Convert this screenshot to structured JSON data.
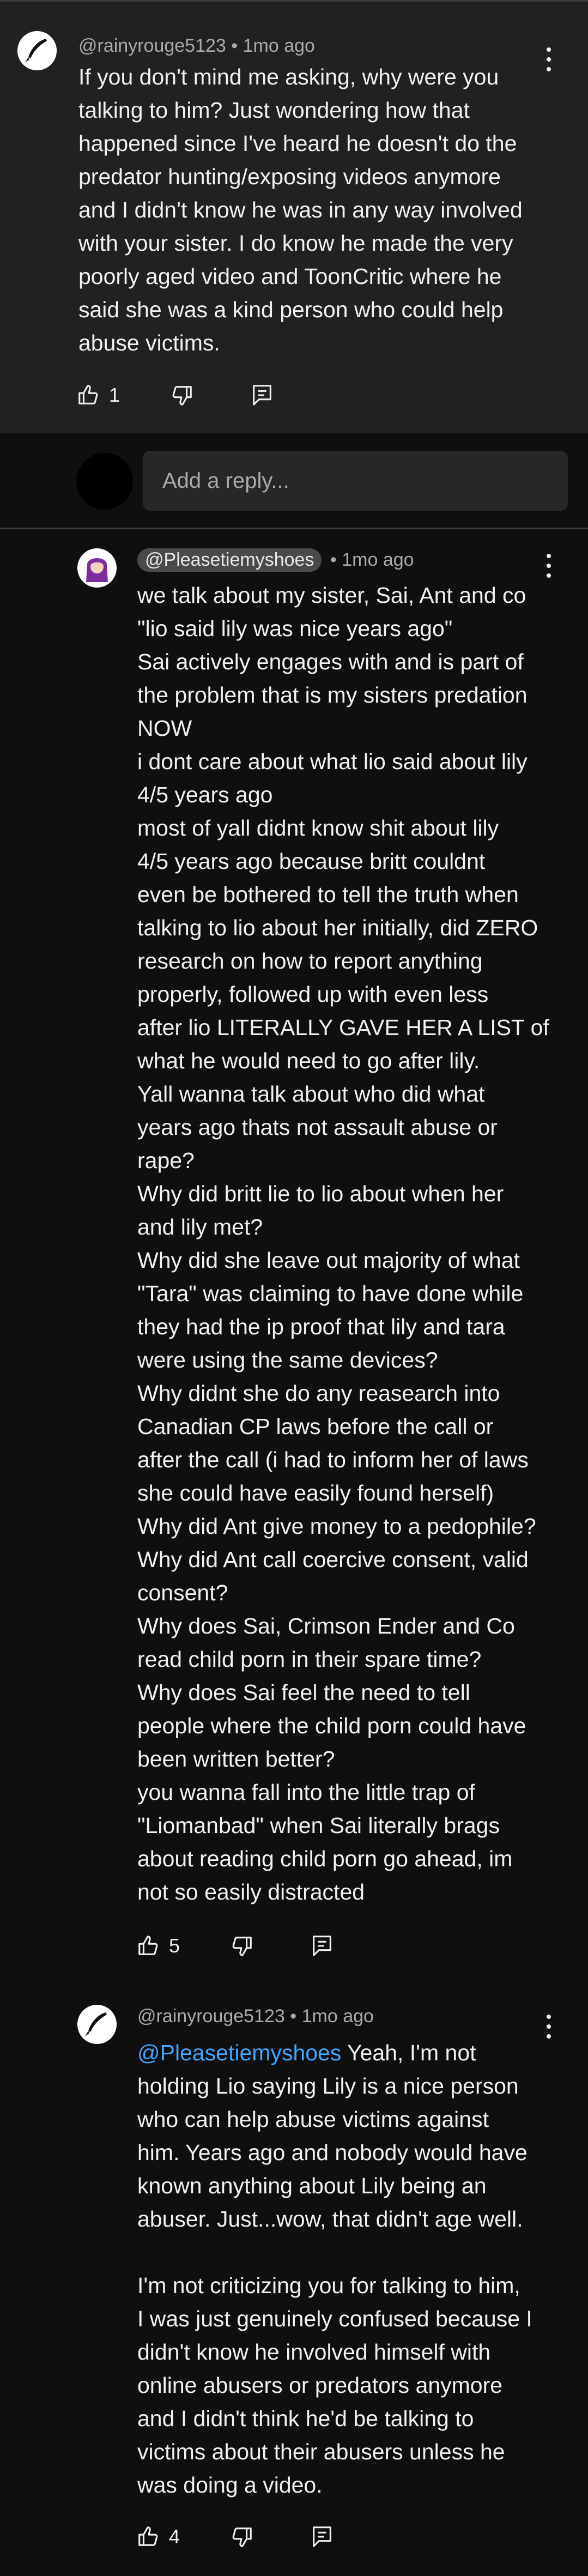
{
  "comment_main": {
    "author": "@rainyrouge5123",
    "time": "1mo ago",
    "text": "If you don't mind me asking, why were you\ntalking to him? Just wondering how that\nhappened since I've heard he doesn't do the\npredator hunting/exposing videos anymore\nand I didn't know he was in any way involved\nwith your sister. I do know he made the very\npoorly aged video and ToonCritic where he\nsaid she was a kind person who could help\nabuse victims.",
    "likes": "1"
  },
  "reply_box": {
    "placeholder": "Add a reply..."
  },
  "reply_1": {
    "author": "@Pleasetiemyshoes",
    "time": "1mo ago",
    "text": "we talk about my sister, Sai, Ant and co\n\"lio said lily was nice years ago\"\nSai actively engages with and is part of\nthe problem that is my sisters predation\nNOW\ni dont care about what lio said about lily\n4/5 years ago\nmost of yall didnt know shit about lily\n4/5 years ago because britt couldnt\neven be bothered to tell the truth when\ntalking to lio about her initially, did ZERO\nresearch on how to report anything\nproperly, followed up with even less\nafter lio LITERALLY GAVE HER A LIST of\nwhat he would need to go after lily.\nYall wanna talk about who did what\nyears ago thats not assault abuse or\nrape?\nWhy did britt lie to lio about when her\nand lily met?\nWhy did she leave out majority of what\n\"Tara\" was claiming to have done while\nthey had the ip proof that lily and tara\nwere using the same devices?\nWhy didnt she do any reasearch into\nCanadian CP laws before the call or\nafter the call (i had to inform her of laws\nshe could have easily found herself)\nWhy did Ant give money to a pedophile?\nWhy did Ant call coercive consent, valid\nconsent?\nWhy does Sai, Crimson Ender and Co\nread child porn in their spare time?\nWhy does Sai feel the need to tell\npeople where the child porn could have\nbeen written better?\nyou wanna fall into the little trap of\n\"Liomanbad\" when Sai literally brags\nabout reading child porn go ahead, im\nnot so easily distracted",
    "likes": "5"
  },
  "reply_2": {
    "author": "@rainyrouge5123",
    "time": "1mo ago",
    "mention": "@Pleasetiemyshoes",
    "text": " Yeah, I'm not\nholding Lio saying Lily is a nice person\nwho can help abuse victims against\nhim. Years ago and nobody would have\nknown anything about Lily being an\nabuser. Just...wow, that didn't age well.\n\nI'm not criticizing you for talking to him,\nI was just genuinely confused because I\ndidn't know he involved himself with\nonline abusers or predators anymore\nand I didn't think he'd be talking to\nvictims about their abusers unless he\nwas doing a video.",
    "likes": "4"
  }
}
